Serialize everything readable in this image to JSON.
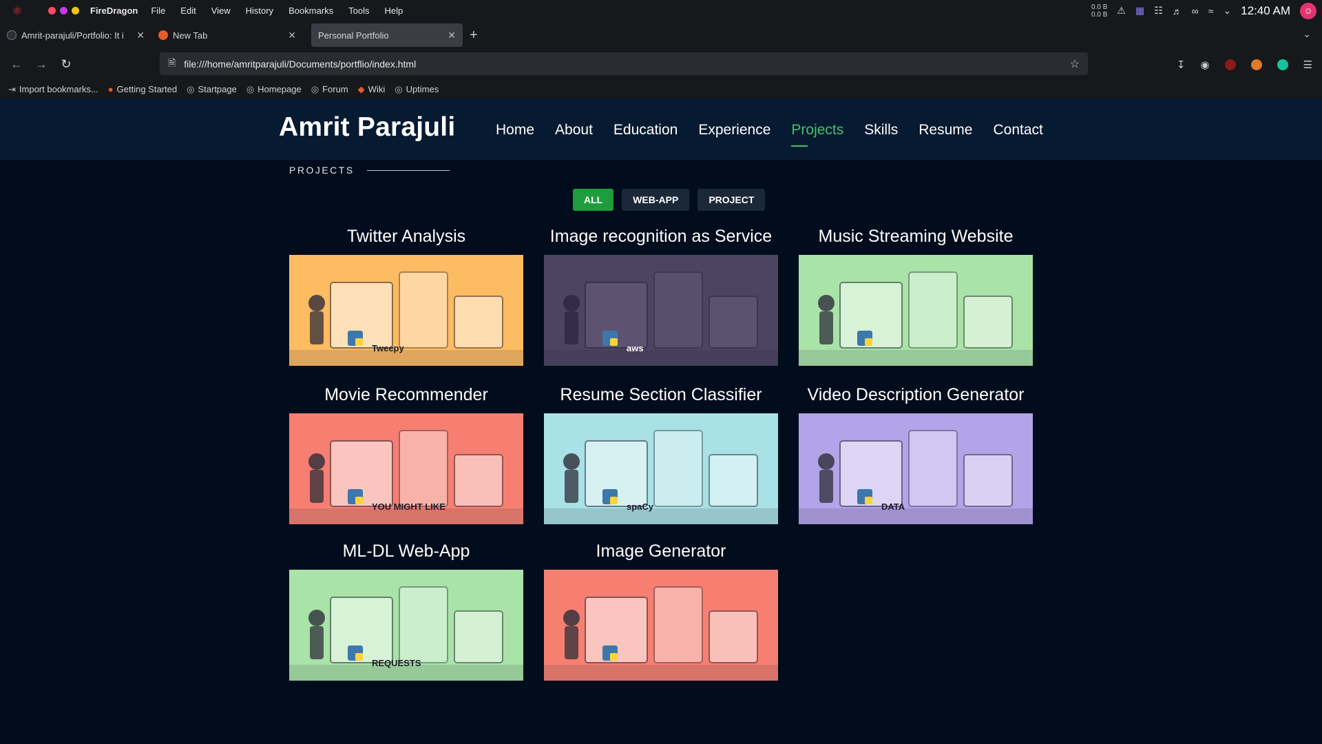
{
  "system": {
    "app_name": "FireDragon",
    "menu": [
      "File",
      "Edit",
      "View",
      "History",
      "Bookmarks",
      "Tools",
      "Help"
    ],
    "net_up": "0.0 B",
    "net_down": "0.0 B",
    "clock": "12:40 AM"
  },
  "tabs": [
    {
      "title": "Amrit-parajuli/Portfolio: It i",
      "icon_color": "#2c2f35"
    },
    {
      "title": "New Tab",
      "icon_color": "#e25c2a"
    },
    {
      "title": "Personal Portfolio",
      "icon_color": ""
    }
  ],
  "address": {
    "url": "file:///home/amritparajuli/Documents/portflio/index.html"
  },
  "bookmarks": [
    "Import bookmarks...",
    "Getting Started",
    "Startpage",
    "Homepage",
    "Forum",
    "Wiki",
    "Uptimes"
  ],
  "site": {
    "brand": "Amrit Parajuli",
    "nav": [
      "Home",
      "About",
      "Education",
      "Experience",
      "Projects",
      "Skills",
      "Resume",
      "Contact"
    ],
    "nav_active": "Projects",
    "section_title": "PROJECTS",
    "filters": [
      "ALL",
      "WEB-APP",
      "PROJECT"
    ],
    "filter_active": "ALL",
    "projects": [
      {
        "title": "Twitter Analysis",
        "bg": "#fdbb62",
        "label": "Tweepy"
      },
      {
        "title": "Image recognition as Service",
        "bg": "#4c4460",
        "label": "aws"
      },
      {
        "title": "Music Streaming Website",
        "bg": "#a9e3a8",
        "label": ""
      },
      {
        "title": "Movie Recommender",
        "bg": "#f67f72",
        "label": "YOU MIGHT LIKE"
      },
      {
        "title": "Resume Section Classifier",
        "bg": "#a8e1e6",
        "label": "spaCy"
      },
      {
        "title": "Video Description Generator",
        "bg": "#b3a3e8",
        "label": "DATA"
      },
      {
        "title": "ML-DL Web-App",
        "bg": "#a9e3a8",
        "label": "REQUESTS"
      },
      {
        "title": "Image Generator",
        "bg": "#f67f72",
        "label": ""
      }
    ]
  },
  "colors": {
    "accent_green": "#49c06d",
    "filter_active": "#1f9d3c",
    "header_bg": "#061a31",
    "page_bg": "#010d1c"
  }
}
